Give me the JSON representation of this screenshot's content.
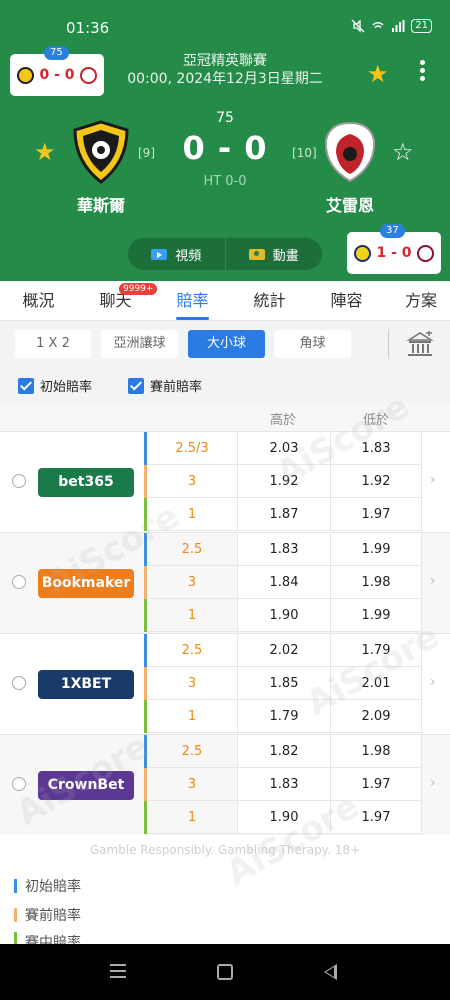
{
  "status_bar": {
    "time": "01:36",
    "battery": "21"
  },
  "mini_score": {
    "badge": "75",
    "score": "0 - 0"
  },
  "match": {
    "league": "亞冠精英聯賽",
    "datetime": "00:00, 2024年12月3日星期二",
    "minute": "75",
    "score": "0 - 0",
    "half_time": "HT 0-0",
    "home": {
      "name": "華斯爾",
      "rank": "[9]"
    },
    "away": {
      "name": "艾雷恩",
      "rank": "[10]"
    }
  },
  "media": {
    "video": "視頻",
    "animation": "動畫"
  },
  "other_match": {
    "badge": "37",
    "score": "1 - 0"
  },
  "tabs": [
    {
      "label": "概況"
    },
    {
      "label": "聊天",
      "badge": "9999+"
    },
    {
      "label": "賠率"
    },
    {
      "label": "統計"
    },
    {
      "label": "陣容"
    },
    {
      "label": "方案"
    }
  ],
  "filters": [
    "1 X 2",
    "亞洲讓球",
    "大小球",
    "角球"
  ],
  "checks": {
    "initial": "初始賠率",
    "pre_match": "賽前賠率"
  },
  "odds_header": {
    "over": "高於",
    "under": "低於"
  },
  "bookmakers": [
    {
      "name": "bet365",
      "color": "#1b7a4a",
      "rows": [
        {
          "line": "2.5/3",
          "over": "2.03",
          "under": "1.83"
        },
        {
          "line": "3",
          "over": "1.92",
          "under": "1.92"
        },
        {
          "line": "1",
          "over": "1.87",
          "under": "1.97"
        }
      ]
    },
    {
      "name": "Bookmaker",
      "color": "#ee7d1b",
      "rows": [
        {
          "line": "2.5",
          "over": "1.83",
          "under": "1.99"
        },
        {
          "line": "3",
          "over": "1.84",
          "under": "1.98"
        },
        {
          "line": "1",
          "over": "1.90",
          "under": "1.99"
        }
      ]
    },
    {
      "name": "1XBET",
      "color": "#1a3a6b",
      "rows": [
        {
          "line": "2.5",
          "over": "2.02",
          "under": "1.79"
        },
        {
          "line": "3",
          "over": "1.85",
          "under": "2.01"
        },
        {
          "line": "1",
          "over": "1.79",
          "under": "2.09"
        }
      ]
    },
    {
      "name": "CrownBet",
      "color": "#5a3894",
      "rows": [
        {
          "line": "2.5",
          "over": "1.82",
          "under": "1.98"
        },
        {
          "line": "3",
          "over": "1.83",
          "under": "1.97"
        },
        {
          "line": "1",
          "over": "1.90",
          "under": "1.97"
        }
      ]
    }
  ],
  "row_colors": [
    "#3b8fe0",
    "#f2b46a",
    "#7cbf3a"
  ],
  "watermark": "AiScore",
  "disclaimer": "Gamble Responsibly. Gambling Therapy. 18+",
  "legend": [
    {
      "label": "初始賠率",
      "color": "#3b8fe0"
    },
    {
      "label": "賽前賠率",
      "color": "#f2b46a"
    },
    {
      "label": "賽中賠率",
      "color": "#7cbf3a"
    }
  ]
}
